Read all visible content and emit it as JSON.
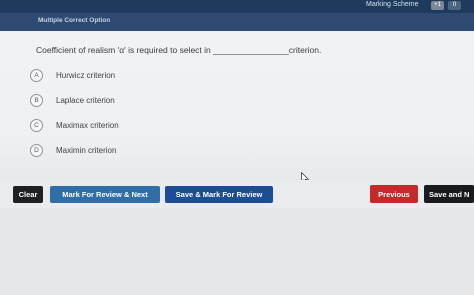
{
  "header": {
    "marking_scheme_label": "Marking Scheme",
    "positive_marks": "+1",
    "negative_marks": "0"
  },
  "question_type": "Multiple Correct Option",
  "question": {
    "text": "Coefficient of realism 'α' is required to select in ________________criterion."
  },
  "options": [
    {
      "letter": "A",
      "text": "Hurwicz criterion"
    },
    {
      "letter": "B",
      "text": "Laplace criterion"
    },
    {
      "letter": "C",
      "text": "Maximax criterion"
    },
    {
      "letter": "D",
      "text": "Maximin criterion"
    }
  ],
  "actions": {
    "clear": "Clear",
    "mark_for_review_next": "Mark For Review & Next",
    "save_mark_for_review": "Save & Mark For Review",
    "previous": "Previous",
    "save_next": "Save and N"
  },
  "colors": {
    "header_bg": "#1e3a5c",
    "question_type_bg": "#2f4a72",
    "clear_bg": "#1f2023",
    "mark_review_bg": "#2f6ea8",
    "save_mark_bg": "#1d4d96",
    "previous_bg": "#c42a2a",
    "save_next_bg": "#1a1b1e"
  },
  "icons": {
    "cursor": "mouse-pointer-icon"
  }
}
